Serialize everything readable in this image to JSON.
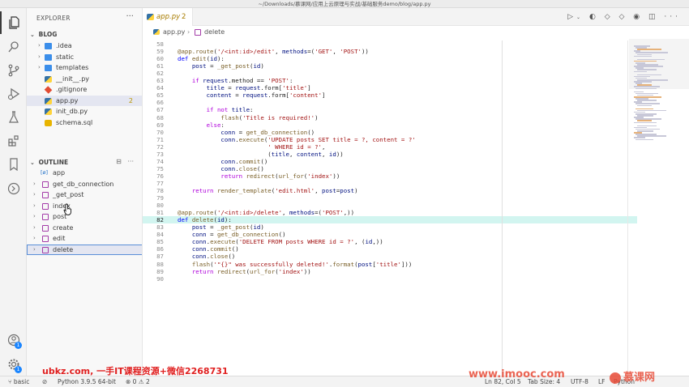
{
  "window": {
    "title": "~/Downloads/慕课网/应用上云原理与实战/基础服务demo/blog/app.py"
  },
  "activity": {
    "accounts_badge": "1",
    "manage_badge": "1"
  },
  "explorer": {
    "title": "EXPLORER",
    "more": "···",
    "root": "BLOG",
    "items": [
      {
        "label": ".idea",
        "icon": "folder-icon",
        "folder": true
      },
      {
        "label": "static",
        "icon": "folder-icon",
        "folder": true
      },
      {
        "label": "templates",
        "icon": "folder-icon",
        "folder": true
      },
      {
        "label": "__init__.py",
        "icon": "python-icon"
      },
      {
        "label": ".gitignore",
        "icon": "git-icon"
      },
      {
        "label": "app.py",
        "icon": "python-icon",
        "count": "2",
        "selected": true
      },
      {
        "label": "init_db.py",
        "icon": "python-icon"
      },
      {
        "label": "schema.sql",
        "icon": "database-icon"
      }
    ]
  },
  "outline": {
    "title": "OUTLINE",
    "items": [
      {
        "label": "app",
        "kind": "variable"
      },
      {
        "label": "get_db_connection",
        "kind": "function"
      },
      {
        "label": "_get_post",
        "kind": "function"
      },
      {
        "label": "index",
        "kind": "function"
      },
      {
        "label": "post",
        "kind": "function"
      },
      {
        "label": "create",
        "kind": "function"
      },
      {
        "label": "edit",
        "kind": "function"
      },
      {
        "label": "delete",
        "kind": "function",
        "focused": true
      }
    ]
  },
  "editor": {
    "tab": {
      "label": "app.py",
      "problems": "2"
    },
    "breadcrumb": {
      "file": "app.py",
      "symbol": "delete"
    },
    "current_line": 82,
    "lines": [
      {
        "n": "58",
        "t": ""
      },
      {
        "n": "59",
        "t": "@app.route('/<int:id>/edit', methods=('GET', 'POST'))"
      },
      {
        "n": "60",
        "t": "def edit(id):"
      },
      {
        "n": "61",
        "t": "    post = _get_post(id)"
      },
      {
        "n": "62",
        "t": ""
      },
      {
        "n": "63",
        "t": "    if request.method == 'POST':"
      },
      {
        "n": "64",
        "t": "        title = request.form['title']"
      },
      {
        "n": "65",
        "t": "        content = request.form['content']"
      },
      {
        "n": "66",
        "t": ""
      },
      {
        "n": "67",
        "t": "        if not title:"
      },
      {
        "n": "68",
        "t": "            flash('Title is required!')"
      },
      {
        "n": "69",
        "t": "        else:"
      },
      {
        "n": "70",
        "t": "            conn = get_db_connection()"
      },
      {
        "n": "71",
        "t": "            conn.execute('UPDATE posts SET title = ?, content = ?'"
      },
      {
        "n": "72",
        "t": "                         ' WHERE id = ?',"
      },
      {
        "n": "73",
        "t": "                         (title, content, id))"
      },
      {
        "n": "74",
        "t": "            conn.commit()"
      },
      {
        "n": "75",
        "t": "            conn.close()"
      },
      {
        "n": "76",
        "t": "            return redirect(url_for('index'))"
      },
      {
        "n": "77",
        "t": ""
      },
      {
        "n": "78",
        "t": "    return render_template('edit.html', post=post)"
      },
      {
        "n": "79",
        "t": ""
      },
      {
        "n": "80",
        "t": ""
      },
      {
        "n": "81",
        "t": "@app.route('/<int:id>/delete', methods=('POST',))"
      },
      {
        "n": "82",
        "t": "def delete(id):"
      },
      {
        "n": "83",
        "t": "    post = _get_post(id)"
      },
      {
        "n": "84",
        "t": "    conn = get_db_connection()"
      },
      {
        "n": "85",
        "t": "    conn.execute('DELETE FROM posts WHERE id = ?', (id,))"
      },
      {
        "n": "86",
        "t": "    conn.commit()"
      },
      {
        "n": "87",
        "t": "    conn.close()"
      },
      {
        "n": "88",
        "t": "    flash('\"{}\" was successfully deleted!'.format(post['title']))"
      },
      {
        "n": "89",
        "t": "    return redirect(url_for('index'))"
      },
      {
        "n": "90",
        "t": ""
      }
    ]
  },
  "status": {
    "branch": "basic",
    "python": "Python 3.9.5 64-bit",
    "errors": "0",
    "warnings": "2",
    "position": "Ln 82, Col 5",
    "tab_size": "Tab Size: 4",
    "encoding": "UTF-8",
    "eol": "LF",
    "language": "Python"
  },
  "watermarks": {
    "left": "ubkz.com, 一手IT课程资源+微信2268731",
    "right": "www.imooc.com",
    "logo": "慕课网"
  }
}
